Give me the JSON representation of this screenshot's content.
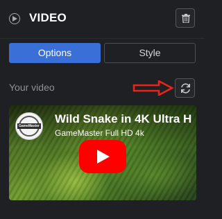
{
  "header": {
    "title": "VIDEO",
    "icons": {
      "play": "play-circle-icon",
      "delete": "trash-icon"
    }
  },
  "tabs": [
    {
      "label": "Options",
      "active": true
    },
    {
      "label": "Style",
      "active": false
    }
  ],
  "video_section": {
    "label": "Your video",
    "refresh_icon": "refresh-icon",
    "annotation_icon": "red-arrow-icon"
  },
  "video": {
    "title": "Wild Snake in 4K Ultra H",
    "channel": "GameMaster Full HD 4k",
    "avatar_text": "GameMaster",
    "play_icon": "youtube-play-icon"
  },
  "colors": {
    "background": "#1f2024",
    "accent": "#3a6fd8",
    "annotation_red": "#e8241b",
    "youtube_red": "#ff0000"
  }
}
